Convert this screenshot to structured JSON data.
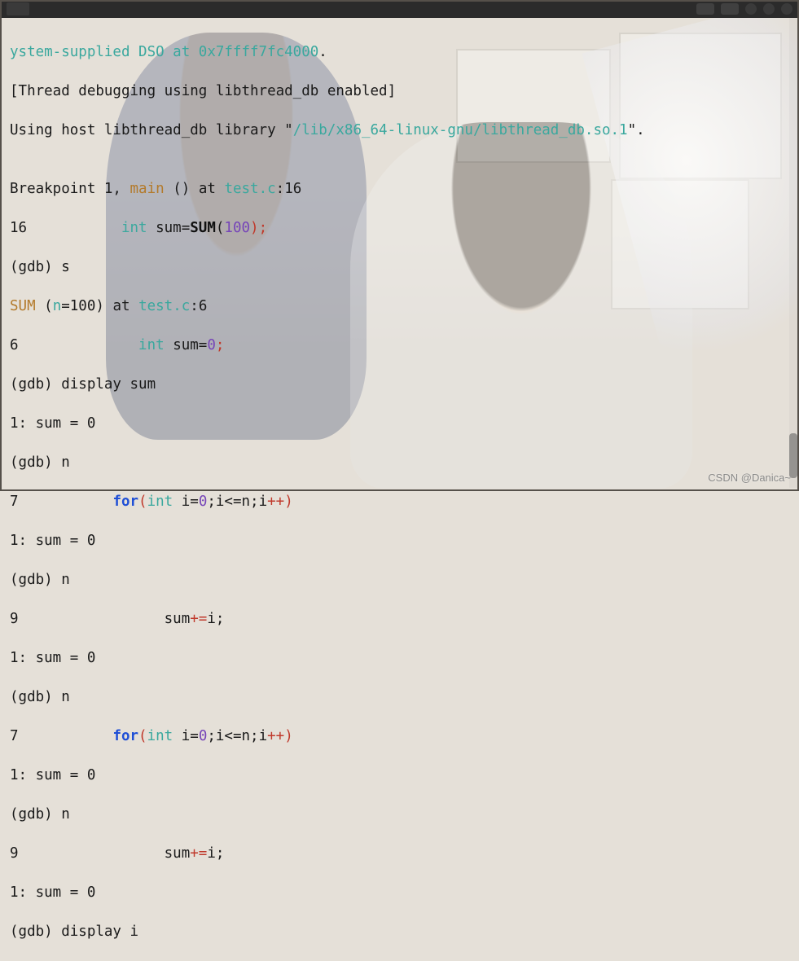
{
  "titlebar": {
    "title": ""
  },
  "watermark": "CSDN @Danica~",
  "lines": {
    "l0a": "ystem-supplied DSO at 0x7ffff7fc4000",
    "l0b": ".",
    "l1": "[Thread debugging using libthread_db enabled]",
    "l2a": "Using host libthread_db library \"",
    "l2b": "/lib/x86_64-linux-gnu/libthread_db.so.1",
    "l2c": "\".",
    "blank": "",
    "l3a": "Breakpoint 1, ",
    "l3b": "main",
    "l3c": " () at ",
    "l3d": "test.c",
    "l3e": ":16",
    "l4a": "16           ",
    "l4b": "int",
    "l4c": " sum=",
    "l4d": "SUM",
    "l4e": "(",
    "l4f": "100",
    "l4g": ");",
    "l5": "(gdb) s",
    "l6a": "SUM",
    "l6b": " (",
    "l6c": "n",
    "l6d": "=100) at ",
    "l6e": "test.c",
    "l6f": ":6",
    "l7a": "6              ",
    "l7b": "int",
    "l7c": " sum=",
    "l7d": "0",
    "l7e": ";",
    "l8": "(gdb) display sum",
    "l9": "1: sum = 0",
    "l10": "(gdb) n",
    "l11a": "7           ",
    "l11b": "for",
    "l11c": "(",
    "l11d": "int",
    "l11e": " i=",
    "l11f": "0",
    "l11g": ";i<=n;i",
    "l11h": "++",
    "l11i": ")",
    "l12": "1: sum = 0",
    "l13": "(gdb) n",
    "l14a": "9                 sum",
    "l14b": "+=",
    "l14c": "i;",
    "l15": "1: sum = 0",
    "l16": "(gdb) n",
    "l17a": "7           ",
    "l17b": "for",
    "l17c": "(",
    "l17d": "int",
    "l17e": " i=",
    "l17f": "0",
    "l17g": ";i<=n;i",
    "l17h": "++",
    "l17i": ")",
    "l18": "1: sum = 0",
    "l19": "(gdb) n",
    "l20a": "9                 sum",
    "l20b": "+=",
    "l20c": "i;",
    "l21": "1: sum = 0",
    "l22": "(gdb) display i"
  }
}
